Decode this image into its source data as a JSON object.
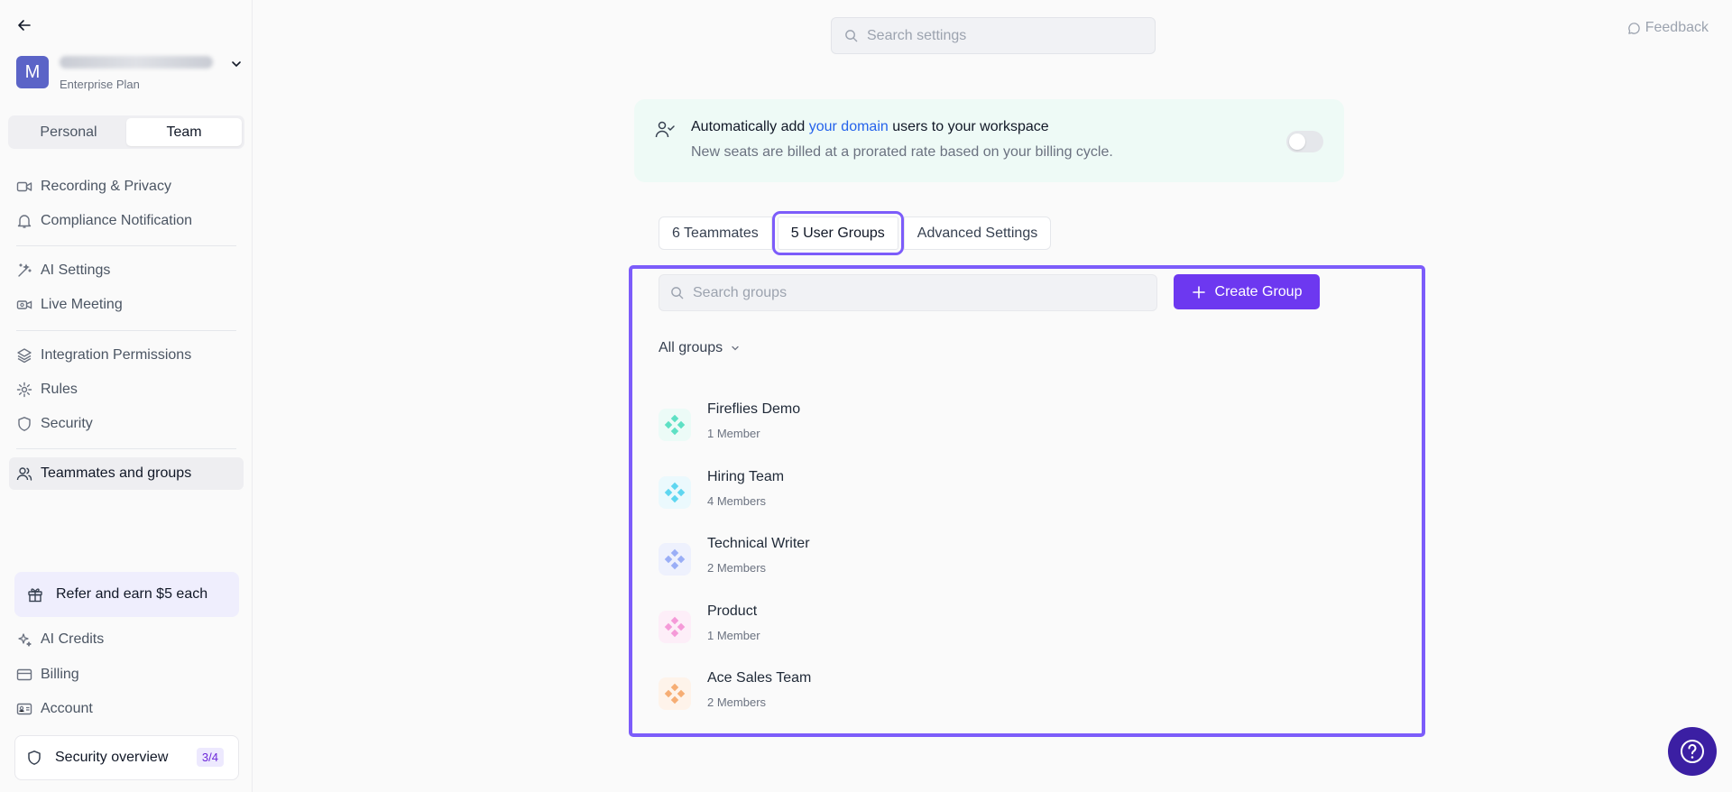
{
  "sidebar": {
    "account": {
      "initial": "M",
      "plan": "Enterprise Plan"
    },
    "segments": {
      "personal": "Personal",
      "team": "Team"
    },
    "nav": [
      {
        "label": "Recording & Privacy"
      },
      {
        "label": "Compliance Notification"
      },
      {
        "label": "AI Settings"
      },
      {
        "label": "Live Meeting"
      },
      {
        "label": "Integration Permissions"
      },
      {
        "label": "Rules"
      },
      {
        "label": "Security"
      },
      {
        "label": "Teammates and groups"
      }
    ],
    "refer": "Refer and earn $5 each",
    "bottom_nav": [
      {
        "label": "AI Credits"
      },
      {
        "label": "Billing"
      },
      {
        "label": "Account"
      }
    ],
    "security_overview": {
      "label": "Security overview",
      "badge": "3/4"
    }
  },
  "header": {
    "search_placeholder": "Search settings",
    "feedback": "Feedback"
  },
  "banner": {
    "title_prefix": "Automatically add ",
    "title_link": "your domain",
    "title_suffix": " users to your workspace",
    "subtitle": "New seats are billed at a prorated rate based on your billing cycle.",
    "toggle_on": false
  },
  "tabs": [
    {
      "label": "6 Teammates"
    },
    {
      "label": "5 User Groups"
    },
    {
      "label": "Advanced Settings"
    }
  ],
  "groups_panel": {
    "search_placeholder": "Search groups",
    "create_label": "Create Group",
    "filter_label": "All groups",
    "groups": [
      {
        "name": "Fireflies Demo",
        "members": "1 Member",
        "color": "#5ee0c4",
        "bg": "#ecfbf7"
      },
      {
        "name": "Hiring Team",
        "members": "4 Members",
        "color": "#5fd6f0",
        "bg": "#ebf9fd"
      },
      {
        "name": "Technical Writer",
        "members": "2 Members",
        "color": "#9aaef6",
        "bg": "#eef1fd"
      },
      {
        "name": "Product",
        "members": "1 Member",
        "color": "#f59ad8",
        "bg": "#fdeef8"
      },
      {
        "name": "Ace Sales Team",
        "members": "2 Members",
        "color": "#f6ad74",
        "bg": "#fef3ea"
      }
    ]
  },
  "colors": {
    "accent": "#6d38f0",
    "highlight": "#7c5cfa"
  }
}
